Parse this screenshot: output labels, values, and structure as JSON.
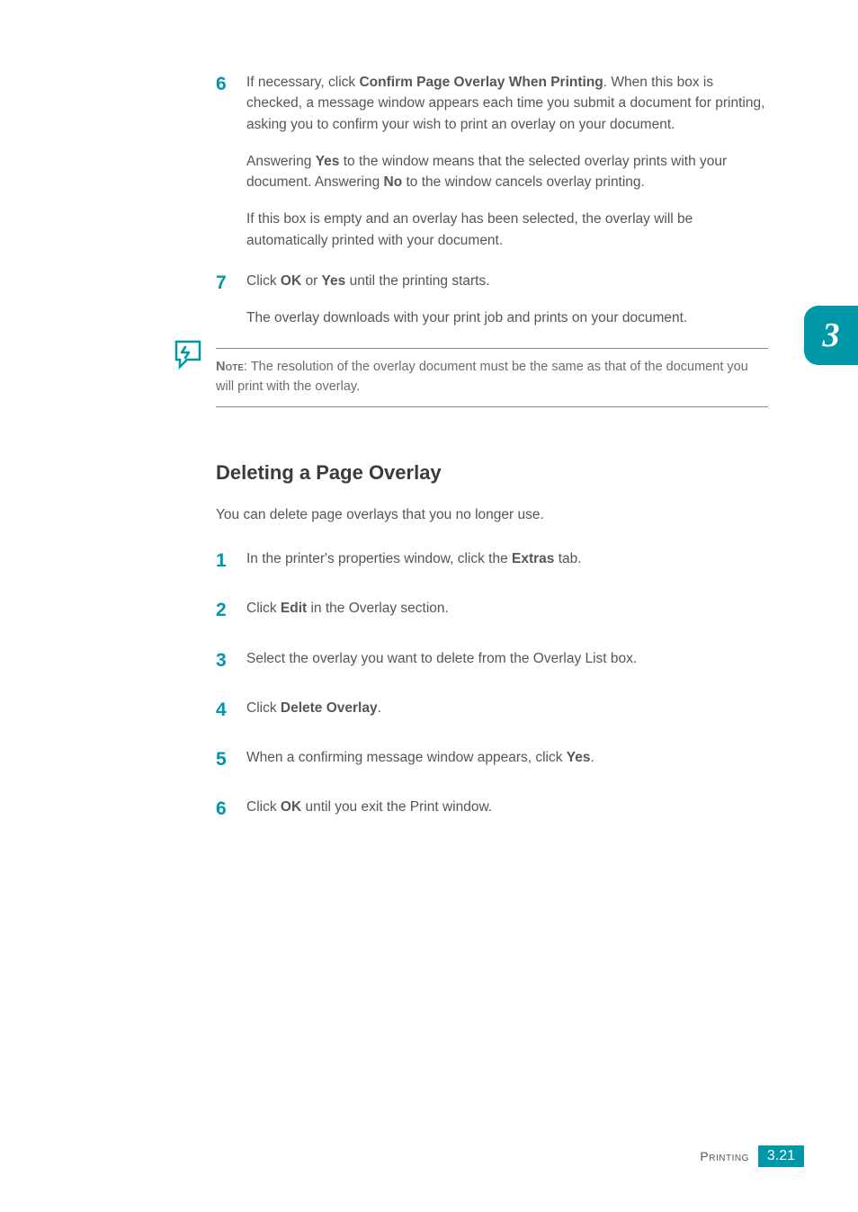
{
  "steps_upper": [
    {
      "num": "6",
      "paragraphs": [
        {
          "segments": [
            {
              "t": "If necessary, click "
            },
            {
              "t": "Confirm Page Overlay When Printing",
              "b": true
            },
            {
              "t": ". When this box is checked, a message window appears each time you submit a document for printing, asking you to confirm your wish to print an overlay on your document."
            }
          ]
        },
        {
          "segments": [
            {
              "t": "Answering "
            },
            {
              "t": "Yes",
              "b": true
            },
            {
              "t": " to the window means that the selected overlay prints with your document. Answering "
            },
            {
              "t": "No",
              "b": true
            },
            {
              "t": " to the window cancels overlay printing."
            }
          ]
        },
        {
          "segments": [
            {
              "t": "If this box is empty and an overlay has been selected, the overlay will be automatically printed with your document."
            }
          ]
        }
      ]
    },
    {
      "num": "7",
      "paragraphs": [
        {
          "segments": [
            {
              "t": "Click "
            },
            {
              "t": "OK",
              "b": true
            },
            {
              "t": " or "
            },
            {
              "t": "Yes",
              "b": true
            },
            {
              "t": " until the printing starts."
            }
          ]
        },
        {
          "segments": [
            {
              "t": "The overlay downloads with your print job and prints on your document."
            }
          ]
        }
      ]
    }
  ],
  "note": {
    "label": "Note",
    "text": ": The resolution of the overlay document must be the same as that of the document you will print with the overlay."
  },
  "heading": "Deleting a Page Overlay",
  "intro": "You can delete page overlays that you no longer use.",
  "steps_lower": [
    {
      "num": "1",
      "segments": [
        {
          "t": "In the printer's properties window, click the "
        },
        {
          "t": "Extras",
          "b": true
        },
        {
          "t": " tab."
        }
      ]
    },
    {
      "num": "2",
      "segments": [
        {
          "t": "Click "
        },
        {
          "t": "Edit",
          "b": true
        },
        {
          "t": " in the Overlay section."
        }
      ]
    },
    {
      "num": "3",
      "segments": [
        {
          "t": "Select the overlay you want to delete from the Overlay List box."
        }
      ]
    },
    {
      "num": "4",
      "segments": [
        {
          "t": "Click "
        },
        {
          "t": "Delete Overlay",
          "b": true
        },
        {
          "t": "."
        }
      ]
    },
    {
      "num": "5",
      "segments": [
        {
          "t": "When a confirming message window appears, click "
        },
        {
          "t": "Yes",
          "b": true
        },
        {
          "t": "."
        }
      ]
    },
    {
      "num": "6",
      "segments": [
        {
          "t": "Click "
        },
        {
          "t": "OK",
          "b": true
        },
        {
          "t": " until you exit the Print window."
        }
      ]
    }
  ],
  "chapter": "3",
  "footer": {
    "label": "Printing",
    "page": "3.21"
  }
}
